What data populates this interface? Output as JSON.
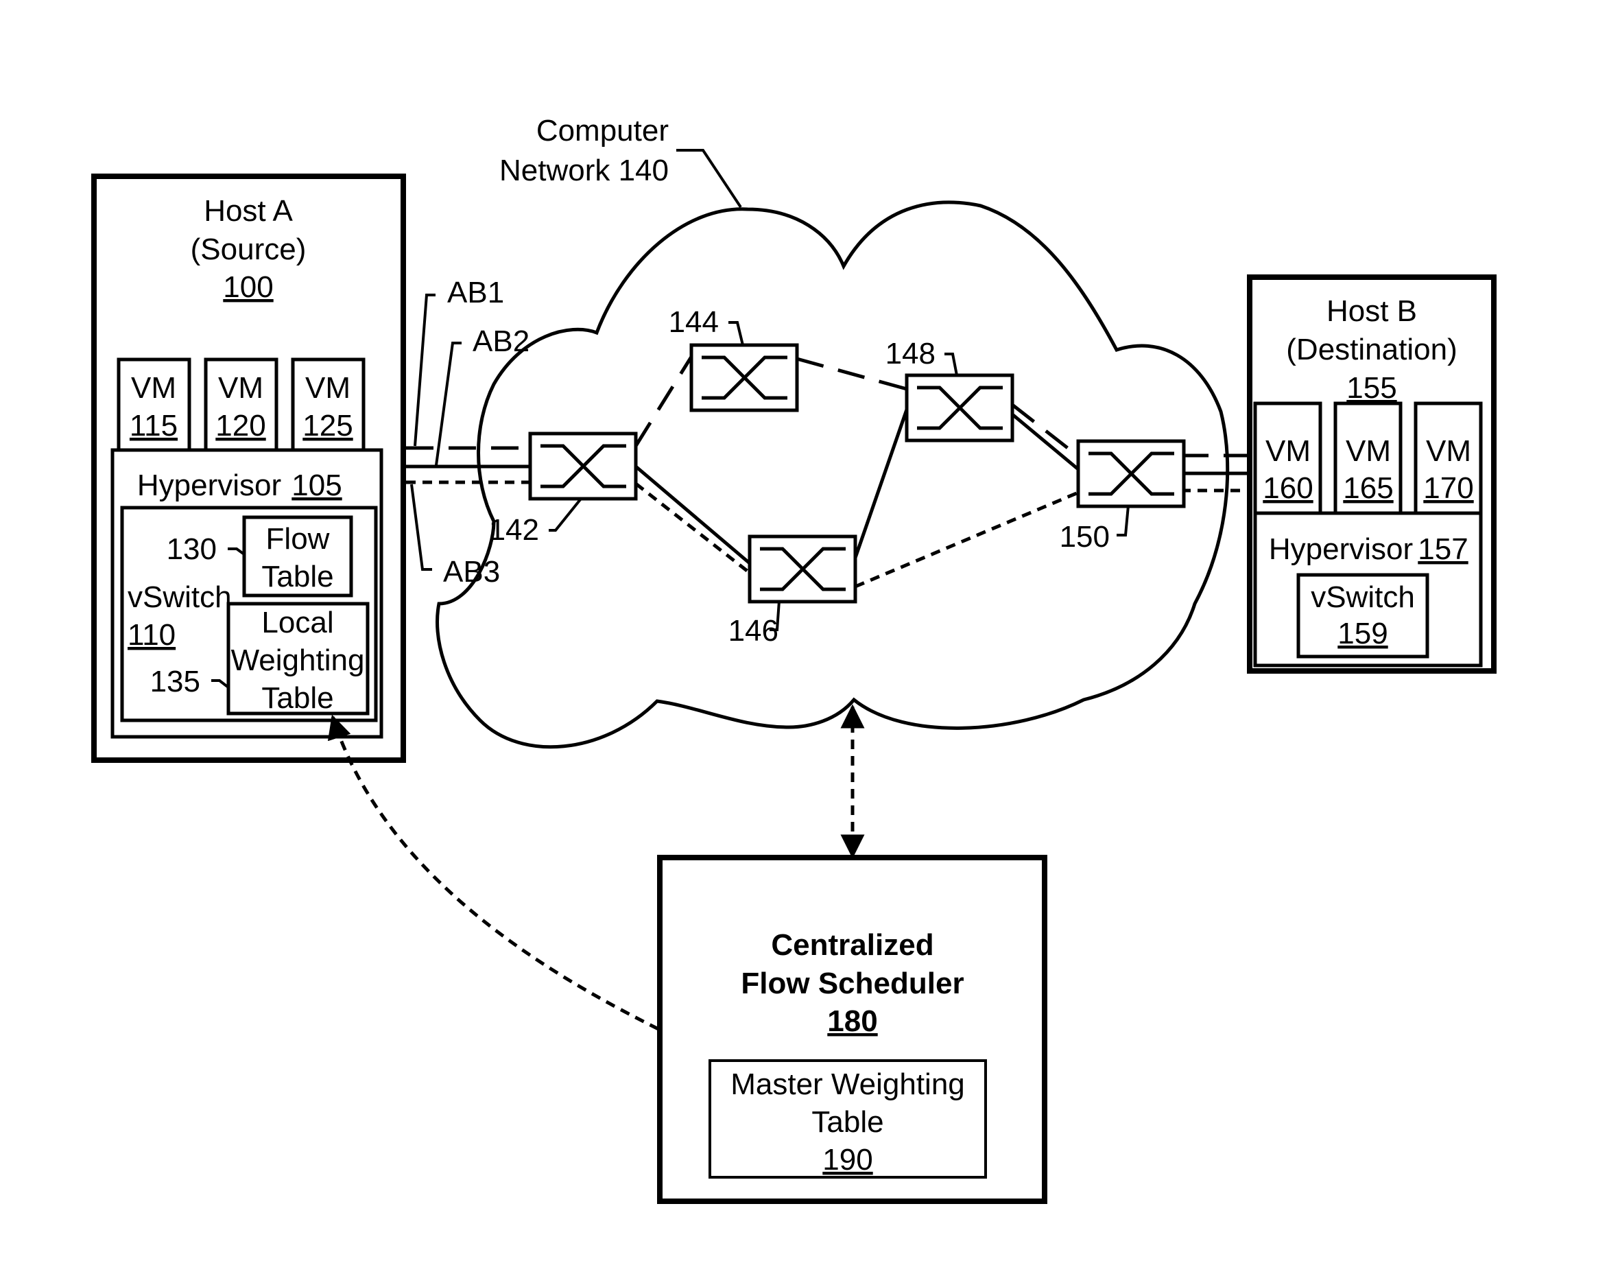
{
  "network": {
    "label_line1": "Computer",
    "label_line2": "Network 140"
  },
  "host_a": {
    "title": "Host A",
    "subtitle": "(Source)",
    "ref": "100",
    "vms": [
      {
        "label": "VM",
        "ref": "115"
      },
      {
        "label": "VM",
        "ref": "120"
      },
      {
        "label": "VM",
        "ref": "125"
      }
    ],
    "hypervisor": {
      "label": "Hypervisor",
      "ref": "105"
    },
    "vswitch": {
      "label": "vSwitch",
      "ref": "110"
    },
    "flow_table": {
      "line1": "Flow",
      "line2": "Table",
      "ref": "130"
    },
    "local_weighting_table": {
      "line1": "Local",
      "line2": "Weighting",
      "line3": "Table",
      "ref": "135"
    }
  },
  "host_b": {
    "title": "Host B",
    "subtitle": "(Destination)",
    "ref": "155",
    "vms": [
      {
        "label": "VM",
        "ref": "160"
      },
      {
        "label": "VM",
        "ref": "165"
      },
      {
        "label": "VM",
        "ref": "170"
      }
    ],
    "hypervisor": {
      "label": "Hypervisor",
      "ref": "157"
    },
    "vswitch": {
      "label": "vSwitch",
      "ref": "159"
    }
  },
  "paths": [
    {
      "name": "AB1",
      "style": "long-dashed",
      "route": [
        "Host A",
        "142",
        "144",
        "148",
        "150",
        "Host B"
      ]
    },
    {
      "name": "AB2",
      "style": "solid",
      "route": [
        "Host A",
        "142",
        "146",
        "148",
        "150",
        "Host B"
      ]
    },
    {
      "name": "AB3",
      "style": "short-dashed",
      "route": [
        "Host A",
        "142",
        "146",
        "150",
        "Host B"
      ]
    }
  ],
  "switches": [
    {
      "ref": "142"
    },
    {
      "ref": "144"
    },
    {
      "ref": "146"
    },
    {
      "ref": "148"
    },
    {
      "ref": "150"
    }
  ],
  "scheduler": {
    "line1": "Centralized",
    "line2": "Flow Scheduler",
    "ref": "180",
    "master_table": {
      "line1": "Master Weighting",
      "line2": "Table",
      "ref": "190"
    }
  }
}
